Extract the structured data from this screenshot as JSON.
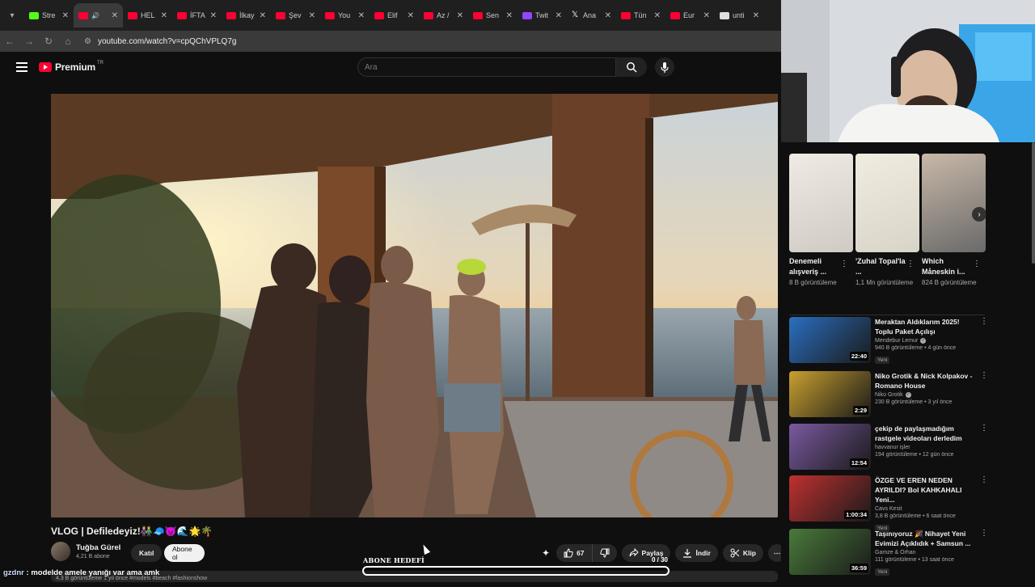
{
  "browser": {
    "tabs": [
      {
        "label": "Stre",
        "icon": "kick"
      },
      {
        "label": "",
        "icon": "youtube",
        "active": true,
        "audio": "🔊"
      },
      {
        "label": "HEL",
        "icon": "youtube"
      },
      {
        "label": "İFTA",
        "icon": "youtube"
      },
      {
        "label": "İlkay",
        "icon": "youtube"
      },
      {
        "label": "Şev",
        "icon": "youtube"
      },
      {
        "label": "You",
        "icon": "youtube"
      },
      {
        "label": "Elif",
        "icon": "youtube"
      },
      {
        "label": "Az /",
        "icon": "youtube"
      },
      {
        "label": "Sen",
        "icon": "youtube"
      },
      {
        "label": "Twit",
        "icon": "twitch"
      },
      {
        "label": "Ana",
        "icon": "x"
      },
      {
        "label": "Tün",
        "icon": "youtube"
      },
      {
        "label": "Eur",
        "icon": "youtube"
      },
      {
        "label": "unti",
        "icon": "doc"
      }
    ],
    "url": "youtube.com/watch?v=cpQChVPLQ7g"
  },
  "header": {
    "logo_text": "Premium",
    "logo_region": "TR",
    "search_placeholder": "Ara"
  },
  "video": {
    "title": "VLOG | Defiledeyiz!👫🧢😈🌊🌟🌴",
    "channel": "Tuğba Gürel",
    "subscribers": "4,21 B abone",
    "join_label": "Katıl",
    "subscribe_label": "Abone ol",
    "likes": "67",
    "share_label": "Paylaş",
    "download_label": "İndir",
    "clip_label": "Klip",
    "meta": "4,3 B görüntüleme  1 yıl önce  #models #beach #fashionshow"
  },
  "overlay": {
    "chat_user": "gzdnr",
    "chat_message": "modelde amele yanığı var ama amk",
    "goal_label": "ABONE HEDEFİ",
    "goal_count": "0 / 30",
    "goal_progress": 0
  },
  "shorts": [
    {
      "title": "Denemeli alışveriş ...",
      "views": "8 B görüntüleme"
    },
    {
      "title": "'Zuhal Topal'la ...",
      "views": "1,1 Mn görüntüleme"
    },
    {
      "title": "Which Måneskin i...",
      "views": "824 B görüntüleme"
    }
  ],
  "recommendations": [
    {
      "title": "Meraktan Aldıklarım 2025! Toplu Paket Açılışı",
      "channel": "Mendebur Lemur",
      "verified": true,
      "stats": "940 B görüntüleme • 4 gün önce",
      "badge": "Yeni",
      "duration": "22:40"
    },
    {
      "title": "Niko Grotik & Nick Kolpakov - Romano House",
      "channel": "Niko Grotik",
      "verified": true,
      "stats": "230 B görüntüleme • 3 yıl önce",
      "badge": "",
      "duration": "2:29"
    },
    {
      "title": "çekip de paylaşmadığım rastgele videoları derledim",
      "channel": "havvanur işler",
      "verified": false,
      "stats": "194 görüntüleme • 12 gün önce",
      "badge": "",
      "duration": "12:54"
    },
    {
      "title": "ÖZGE VE EREN NEDEN AYRILDI? Bol KAHKAHALI Yeni...",
      "channel": "Cavs Kesit",
      "verified": false,
      "stats": "3,8 B görüntüleme • 6 saat önce",
      "badge": "Yeni",
      "duration": "1:00:34"
    },
    {
      "title": "Taşınıyoruz 🎉 Nihayet Yeni Evimizi Açıklıdık + Samsun ...",
      "channel": "Gamze & Orhan",
      "verified": false,
      "stats": "111 görüntüleme • 13 saat önce",
      "badge": "Yeni",
      "duration": "36:59"
    }
  ]
}
